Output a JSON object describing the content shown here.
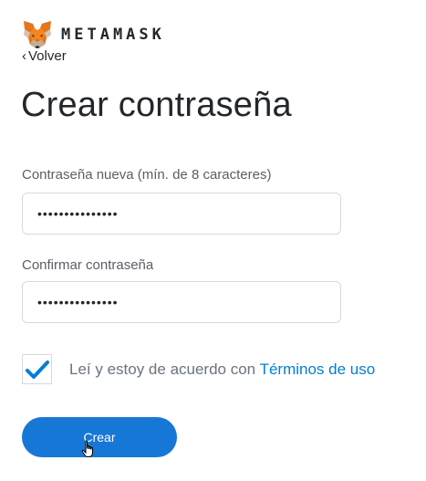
{
  "header": {
    "brand_text": "METAMASK",
    "logo_icon": "metamask-fox-icon"
  },
  "nav": {
    "back_chevron": "‹",
    "back_label": "Volver"
  },
  "main": {
    "title": "Crear contraseña",
    "new_password": {
      "label": "Contraseña nueva (mín. de 8 caracteres)",
      "value": "•••••••••••••••"
    },
    "confirm_password": {
      "label": "Confirmar contraseña",
      "value": "•••••••••••••••"
    },
    "terms": {
      "checked": true,
      "text": "Leí y estoy de acuerdo con ",
      "link_label": "Términos de uso"
    },
    "create_button_label": "Crear"
  },
  "colors": {
    "accent": "#037dd6",
    "button": "#1777d6",
    "fox_orange": "#e2761b",
    "text": "#24272a"
  }
}
